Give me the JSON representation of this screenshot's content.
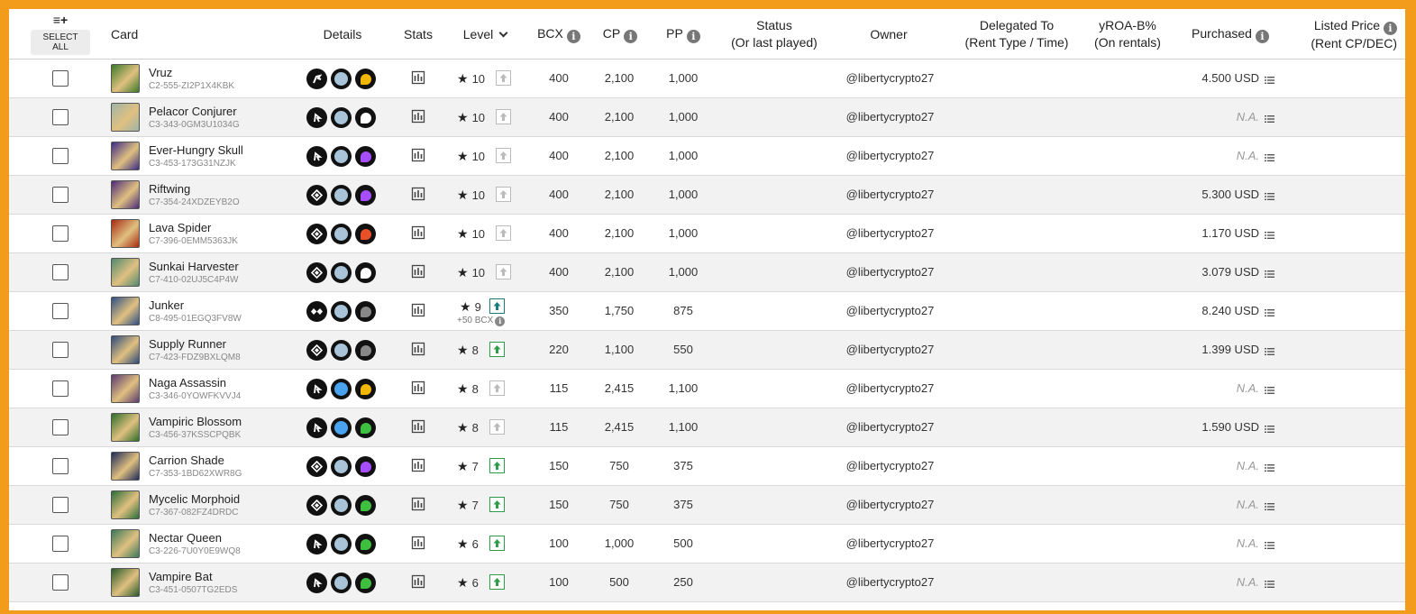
{
  "header": {
    "select_all": "SELECT ALL",
    "add_icon": "≡+",
    "card": "Card",
    "details": "Details",
    "stats": "Stats",
    "level": "Level",
    "bcx": "BCX",
    "cp": "CP",
    "pp": "PP",
    "status": "Status",
    "status_sub": "(Or last played)",
    "owner": "Owner",
    "delegated": "Delegated To",
    "delegated_sub": "(Rent Type / Time)",
    "yroa": "yROA-B%",
    "yroa_sub": "(On rentals)",
    "purchased": "Purchased",
    "listed": "Listed Price",
    "listed_sub": "(Rent CP/DEC)"
  },
  "cards": [
    {
      "name": "Vruz",
      "uid": "C2-555-ZI2P1X4KBK",
      "level": "10",
      "bcx": "400",
      "cp": "2,100",
      "pp": "1,000",
      "owner": "@libertycrypto27",
      "purchased": "4.500 USD",
      "na": false,
      "thumb": "#3d7a2a",
      "el": "#f2b705",
      "role": "A",
      "up": "grey",
      "sub": ""
    },
    {
      "name": "Pelacor Conjurer",
      "uid": "C3-343-0GM3U1034G",
      "level": "10",
      "bcx": "400",
      "cp": "2,100",
      "pp": "1,000",
      "owner": "@libertycrypto27",
      "purchased": "N.A.",
      "na": true,
      "thumb": "#9fb5a8",
      "el": "#ffffff",
      "role": "B",
      "up": "grey",
      "sub": ""
    },
    {
      "name": "Ever-Hungry Skull",
      "uid": "C3-453-173G31NZJK",
      "level": "10",
      "bcx": "400",
      "cp": "2,100",
      "pp": "1,000",
      "owner": "@libertycrypto27",
      "purchased": "N.A.",
      "na": true,
      "thumb": "#3b2c86",
      "el": "#a64dff",
      "role": "B",
      "up": "grey",
      "sub": ""
    },
    {
      "name": "Riftwing",
      "uid": "C7-354-24XDZEYB2O",
      "level": "10",
      "bcx": "400",
      "cp": "2,100",
      "pp": "1,000",
      "owner": "@libertycrypto27",
      "purchased": "5.300 USD",
      "na": false,
      "thumb": "#4b2a7a",
      "el": "#a64dff",
      "role": "C",
      "up": "grey",
      "sub": ""
    },
    {
      "name": "Lava Spider",
      "uid": "C7-396-0EMM5363JK",
      "level": "10",
      "bcx": "400",
      "cp": "2,100",
      "pp": "1,000",
      "owner": "@libertycrypto27",
      "purchased": "1.170 USD",
      "na": false,
      "thumb": "#a82a12",
      "el": "#e8502a",
      "role": "C",
      "up": "grey",
      "sub": ""
    },
    {
      "name": "Sunkai Harvester",
      "uid": "C7-410-02UJ5C4P4W",
      "level": "10",
      "bcx": "400",
      "cp": "2,100",
      "pp": "1,000",
      "owner": "@libertycrypto27",
      "purchased": "3.079 USD",
      "na": false,
      "thumb": "#4f8a6e",
      "el": "#ffffff",
      "role": "C",
      "up": "grey",
      "sub": ""
    },
    {
      "name": "Junker",
      "uid": "C8-495-01EGQ3FV8W",
      "level": "9",
      "bcx": "350",
      "cp": "1,750",
      "pp": "875",
      "owner": "@libertycrypto27",
      "purchased": "8.240 USD",
      "na": false,
      "thumb": "#2e4f86",
      "el": "#888888",
      "role": "D",
      "up": "teal",
      "sub": "+50 BCX"
    },
    {
      "name": "Supply Runner",
      "uid": "C7-423-FDZ9BXLQM8",
      "level": "8",
      "bcx": "220",
      "cp": "1,100",
      "pp": "550",
      "owner": "@libertycrypto27",
      "purchased": "1.399 USD",
      "na": false,
      "thumb": "#2c4a7a",
      "el": "#888888",
      "role": "C",
      "up": "green",
      "sub": ""
    },
    {
      "name": "Naga Assassin",
      "uid": "C3-346-0YOWFKVVJ4",
      "level": "8",
      "bcx": "115",
      "cp": "2,415",
      "pp": "1,100",
      "owner": "@libertycrypto27",
      "purchased": "N.A.",
      "na": true,
      "thumb": "#5a3a6e",
      "el": "#f2b705",
      "role": "B",
      "up": "grey",
      "sub": "",
      "blue": true
    },
    {
      "name": "Vampiric Blossom",
      "uid": "C3-456-37KSSCPQBK",
      "level": "8",
      "bcx": "115",
      "cp": "2,415",
      "pp": "1,100",
      "owner": "@libertycrypto27",
      "purchased": "1.590 USD",
      "na": false,
      "thumb": "#2e6e2a",
      "el": "#3fbf3f",
      "role": "B",
      "up": "grey",
      "sub": "",
      "blue": true
    },
    {
      "name": "Carrion Shade",
      "uid": "C7-353-1BD62XWR8G",
      "level": "7",
      "bcx": "150",
      "cp": "750",
      "pp": "375",
      "owner": "@libertycrypto27",
      "purchased": "N.A.",
      "na": true,
      "thumb": "#1e2a5a",
      "el": "#a64dff",
      "role": "C",
      "up": "green",
      "sub": ""
    },
    {
      "name": "Mycelic Morphoid",
      "uid": "C7-367-082FZ4DRDC",
      "level": "7",
      "bcx": "150",
      "cp": "750",
      "pp": "375",
      "owner": "@libertycrypto27",
      "purchased": "N.A.",
      "na": true,
      "thumb": "#2a6e3a",
      "el": "#3fbf3f",
      "role": "C",
      "up": "green",
      "sub": ""
    },
    {
      "name": "Nectar Queen",
      "uid": "C3-226-7U0Y0E9WQ8",
      "level": "6",
      "bcx": "100",
      "cp": "1,000",
      "pp": "500",
      "owner": "@libertycrypto27",
      "purchased": "N.A.",
      "na": true,
      "thumb": "#3a7a5a",
      "el": "#3fbf3f",
      "role": "B",
      "up": "green",
      "sub": ""
    },
    {
      "name": "Vampire Bat",
      "uid": "C3-451-0507TG2EDS",
      "level": "6",
      "bcx": "100",
      "cp": "500",
      "pp": "250",
      "owner": "@libertycrypto27",
      "purchased": "N.A.",
      "na": true,
      "thumb": "#2a5a2a",
      "el": "#3fbf3f",
      "role": "B",
      "up": "green",
      "sub": ""
    }
  ]
}
